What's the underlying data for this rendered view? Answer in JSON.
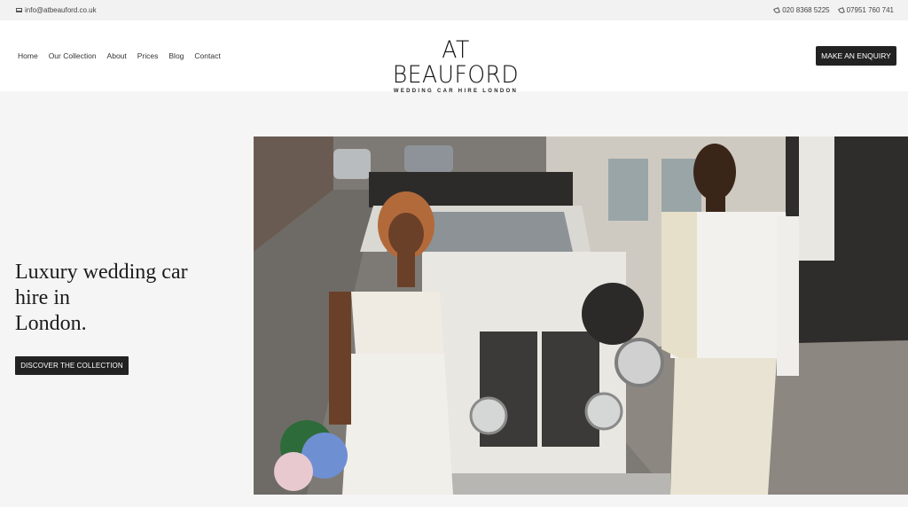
{
  "topbar": {
    "email": "info@atbeauford.co.uk",
    "phone_1": "020 8368 5225",
    "phone_2": "07951 760 741"
  },
  "header": {
    "nav": [
      {
        "label": "Home"
      },
      {
        "label": "Our Collection"
      },
      {
        "label": "About"
      },
      {
        "label": "Prices"
      },
      {
        "label": "Blog"
      },
      {
        "label": "Contact"
      }
    ],
    "logo_title": "AT BEAUFORD",
    "logo_tagline": "WEDDING CAR HIRE LONDON",
    "enquiry_label": "MAKE AN ENQUIRY"
  },
  "hero": {
    "heading_line_1": "Luxury wedding car",
    "heading_line_2": "hire in",
    "heading_line_3": "London.",
    "cta_label": "DISCOVER THE COLLECTION"
  },
  "icons": {
    "email": "mail-icon",
    "phone": "phone-icon"
  },
  "colors": {
    "dark_button": "#222222",
    "page_bg": "#f5f5f5",
    "header_bg": "#ffffff"
  }
}
